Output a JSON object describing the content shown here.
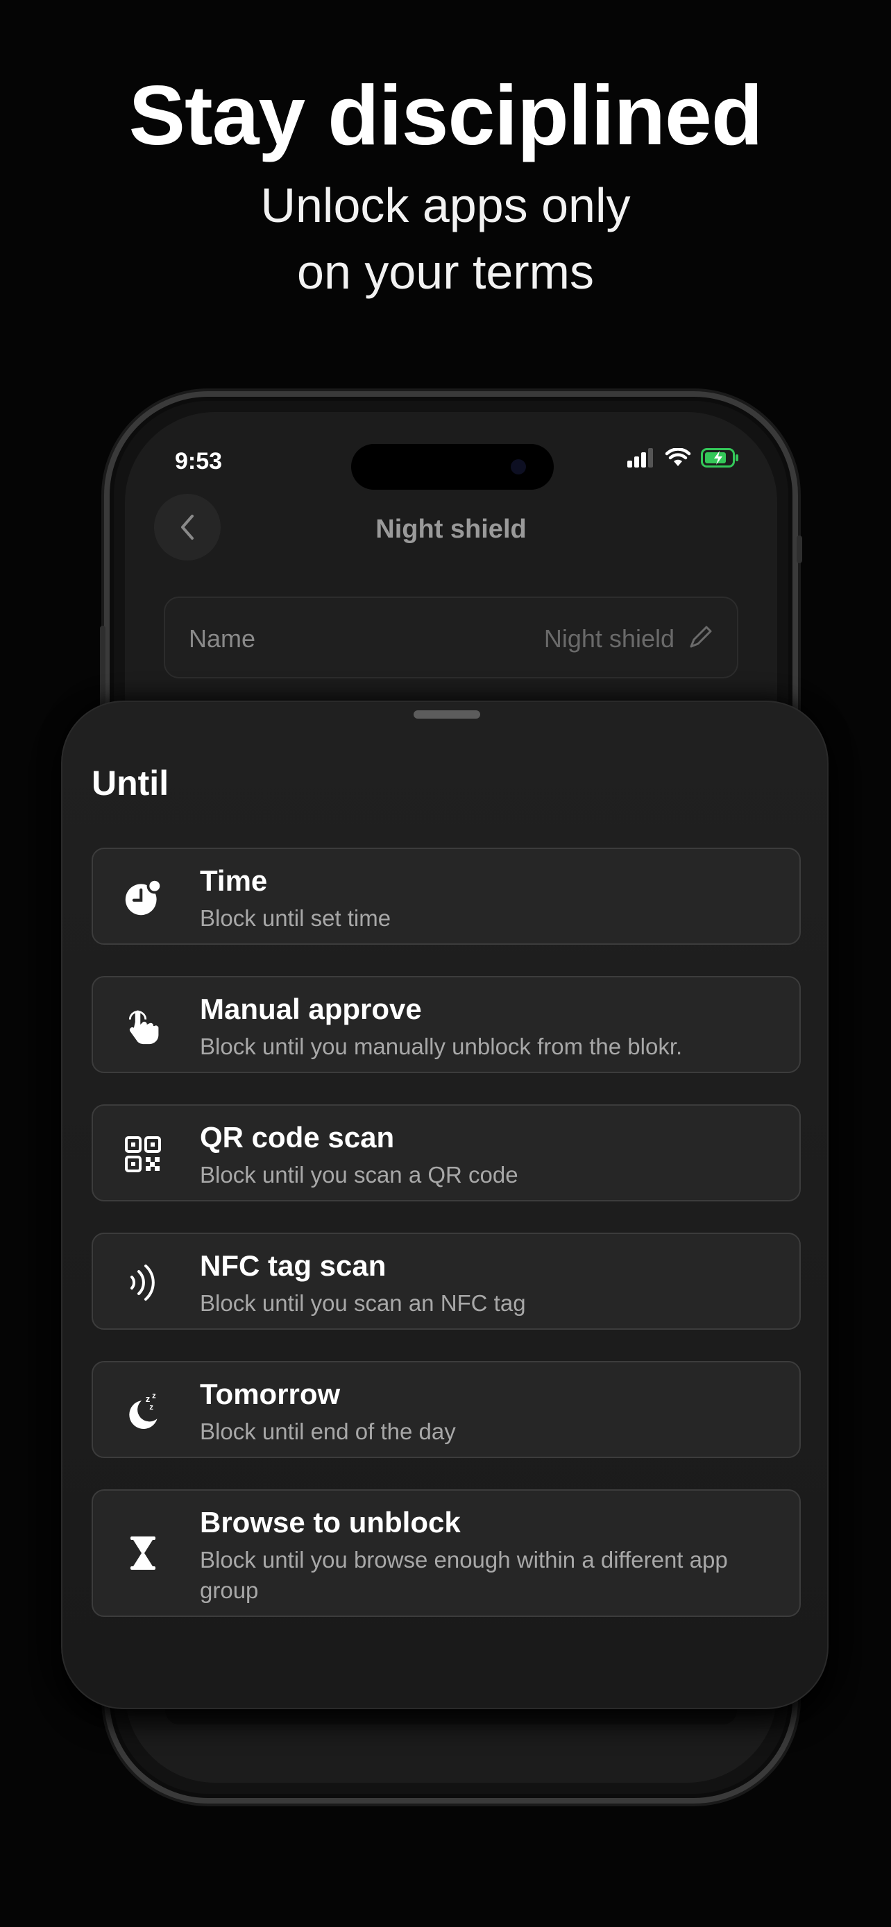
{
  "headline": {
    "title": "Stay disciplined",
    "subtitle_line1": "Unlock apps only",
    "subtitle_line2": "on your terms"
  },
  "status_bar": {
    "time": "9:53"
  },
  "nav": {
    "title": "Night shield",
    "back_icon": "chevron-left-icon"
  },
  "name_field": {
    "label": "Name",
    "value": "Night shield",
    "icon": "pencil-icon"
  },
  "sheet": {
    "title": "Until",
    "options": [
      {
        "title": "Time",
        "description": "Block until set time",
        "icon": "clock-icon"
      },
      {
        "title": "Manual approve",
        "description": "Block until you manually unblock from the blokr.",
        "icon": "hand-tap-icon"
      },
      {
        "title": "QR code scan",
        "description": "Block until you scan a QR code",
        "icon": "qr-code-icon"
      },
      {
        "title": "NFC tag scan",
        "description": "Block until you scan an NFC tag",
        "icon": "nfc-icon"
      },
      {
        "title": "Tomorrow",
        "description": "Block until end of the day",
        "icon": "moon-sleep-icon"
      },
      {
        "title": "Browse to unblock",
        "description": "Block until you browse enough within a different app group",
        "icon": "hourglass-icon"
      }
    ]
  },
  "colors": {
    "background": "#050505",
    "sheet": "#1e1e1e",
    "option": "#262626",
    "battery": "#34c759"
  }
}
